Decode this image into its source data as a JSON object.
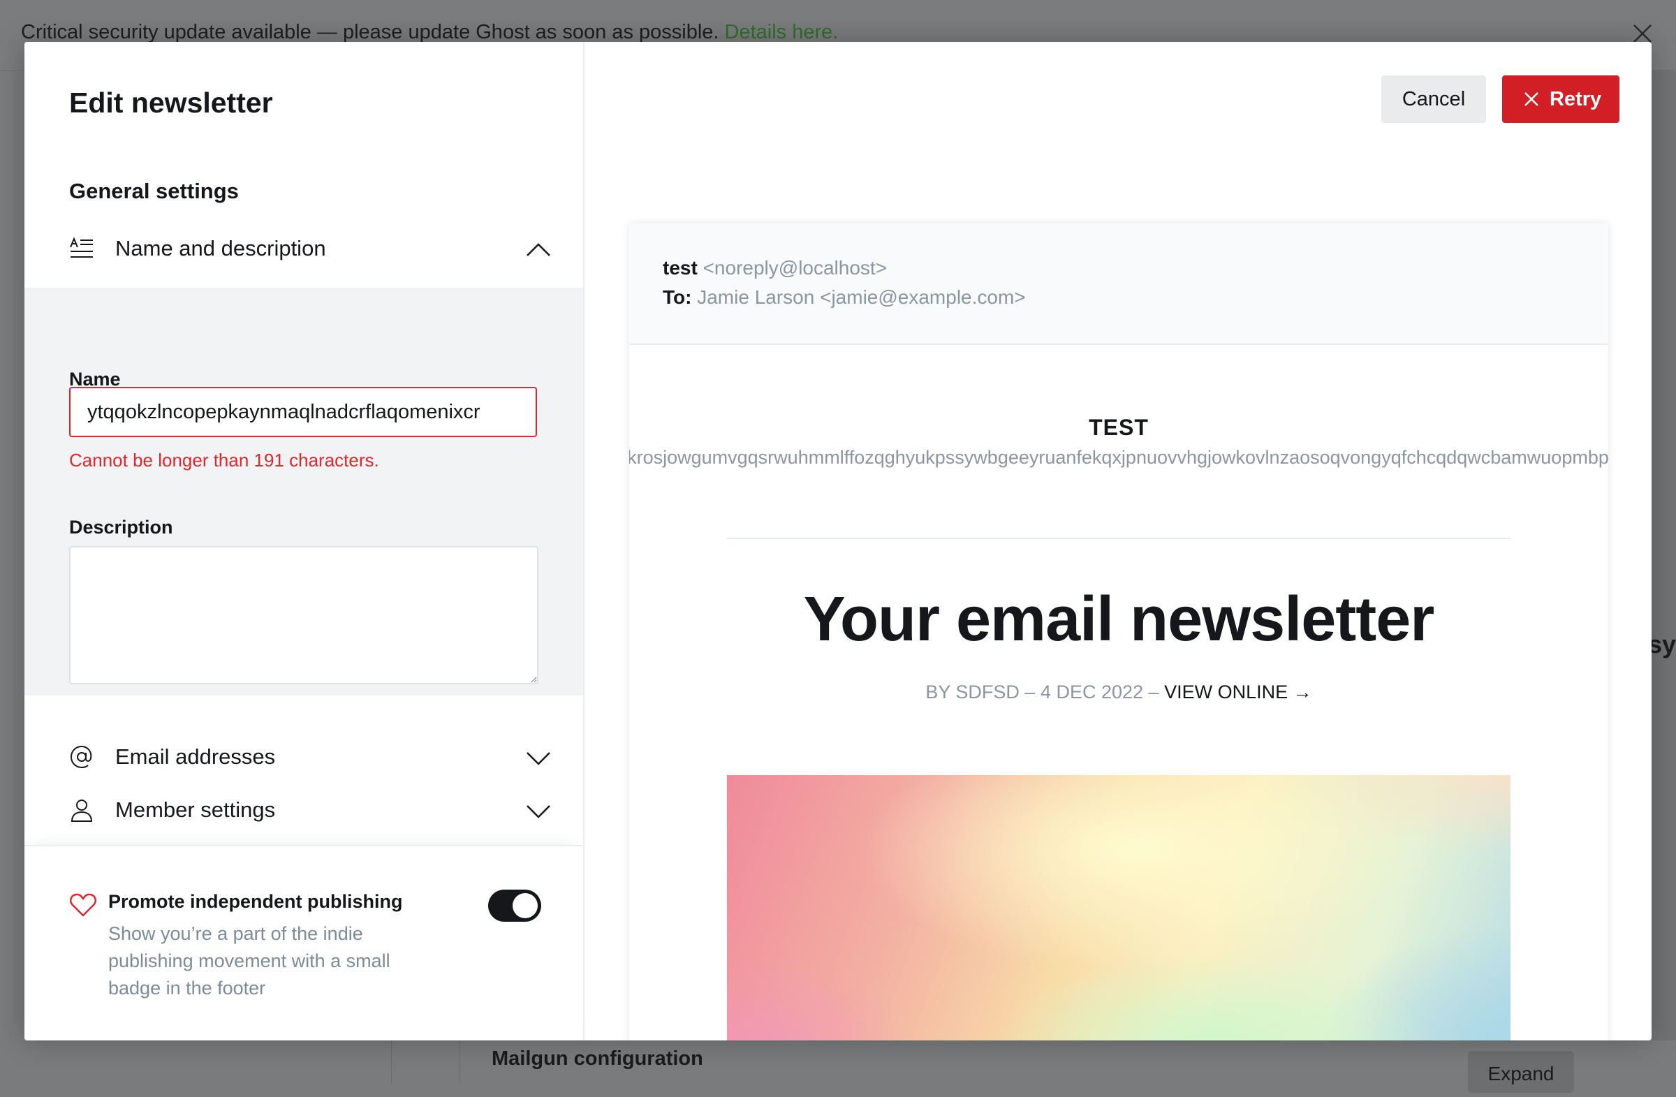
{
  "banner": {
    "message": "Critical security update available — please update Ghost as soon as possible.",
    "link": "Details here."
  },
  "background": {
    "mailgun_title": "Mailgun configuration",
    "expand_label": "Expand",
    "partial_text": "sy"
  },
  "modal": {
    "title": "Edit newsletter",
    "section_title": "General settings",
    "accordions": {
      "name_description": "Name and description",
      "email_addresses": "Email addresses",
      "member_settings": "Member settings"
    },
    "name_field": {
      "label": "Name",
      "value": "ytqqokzlncopepkaynmaqlnadcrflaqomenixcr",
      "error": "Cannot be longer than 191 characters."
    },
    "description_field": {
      "label": "Description",
      "value": ""
    },
    "promote": {
      "title": "Promote independent publishing",
      "description": "Show you’re a part of the indie publishing movement with a small badge in the footer",
      "enabled": true
    },
    "buttons": {
      "cancel": "Cancel",
      "retry": "Retry"
    }
  },
  "preview": {
    "from_name": "test",
    "from_email": "<noreply@localhost>",
    "to_label": "To:",
    "to_value": "Jamie Larson <jamie@example.com>",
    "newsletter_name": "TEST",
    "newsletter_description": "krosjowgumvgqsrwuhmmlffozqghyukpssywbgeeyruanfekqxjpnuovvhgjowkovlnzaosoqvongyqfchcqdqwcbamwuopmbp",
    "headline": "Your email newsletter",
    "byline": "BY SDFSD – 4 DEC 2022 – ",
    "view_online": "VIEW ONLINE →"
  },
  "colors": {
    "error": "#e0272b",
    "retry": "#d21e25",
    "link": "#2f6e2a"
  }
}
